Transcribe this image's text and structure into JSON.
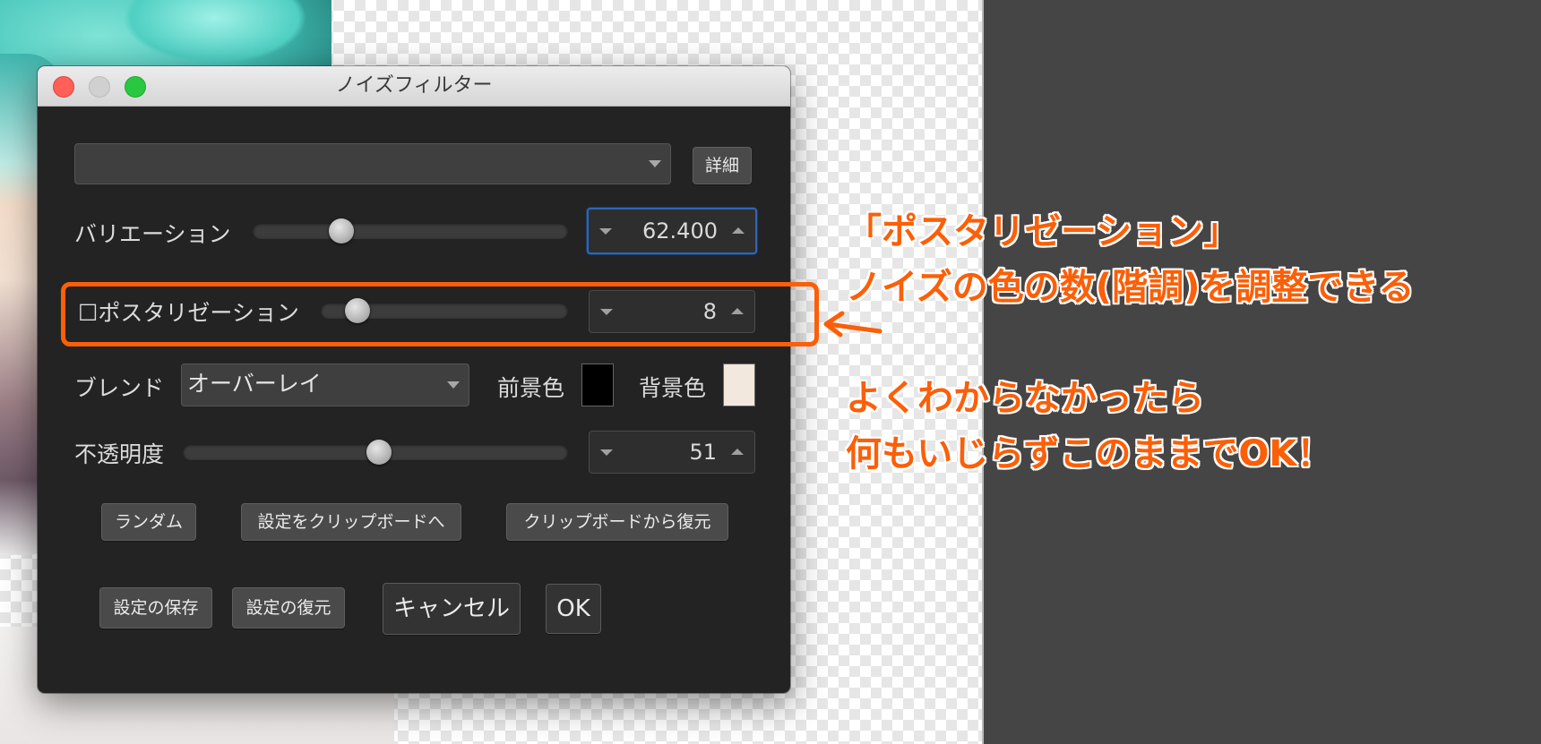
{
  "dialog": {
    "title": "ノイズフィルター",
    "preset_dropdown": {
      "value": ""
    },
    "details_button": "詳細",
    "variation": {
      "label": "バリエーション",
      "value": "62.400",
      "slider_fraction": 0.28
    },
    "posterization": {
      "checkbox": "☐",
      "label": "ポスタリゼーション",
      "value": "8",
      "slider_fraction": 0.15,
      "checked": false
    },
    "blend": {
      "label": "ブレンド",
      "value": "オーバーレイ"
    },
    "foreground": {
      "label": "前景色",
      "color": "#000000"
    },
    "background": {
      "label": "背景色",
      "color": "#f3e8dd"
    },
    "opacity": {
      "label": "不透明度",
      "value": "51",
      "slider_fraction": 0.51
    },
    "buttons_row1": [
      "ランダム",
      "設定をクリップボードへ",
      "クリップボードから復元"
    ],
    "buttons_row2": {
      "save": "設定の保存",
      "restore": "設定の復元",
      "cancel": "キャンセル",
      "ok": "OK"
    }
  },
  "annotation": {
    "line1": "「ポスタリゼーション」",
    "line2": "ノイズの色の数(階調)を調整できる",
    "line3": "よくわからなかったら",
    "line4": "何もいじらずこのままでOK！",
    "color": "#fb5f08"
  }
}
